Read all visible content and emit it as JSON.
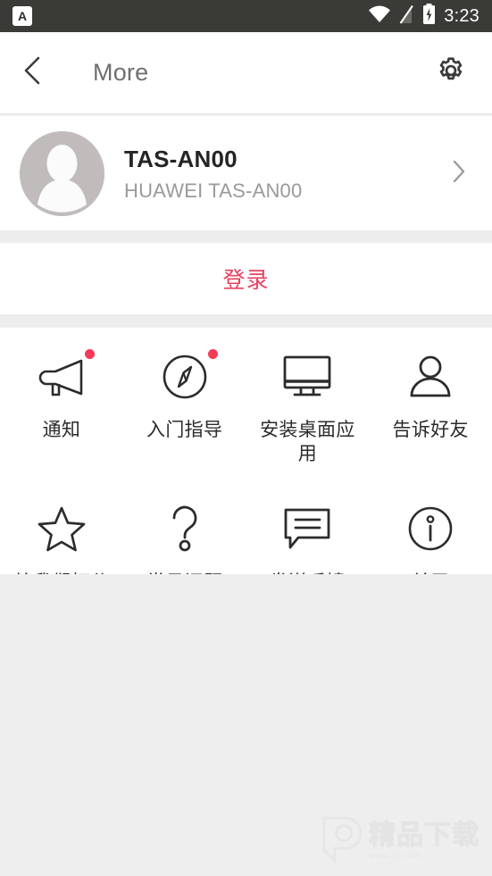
{
  "status_bar": {
    "app_badge_letter": "A",
    "wifi_icon": "wifi-icon",
    "signal_icon": "signal-off-icon",
    "battery_icon": "battery-charging-icon",
    "clock": "3:23",
    "background_color": "#3a3a36"
  },
  "app_bar": {
    "back_icon": "chevron-left-icon",
    "title": "More",
    "settings_icon": "gear-icon"
  },
  "profile": {
    "avatar_icon": "person-placeholder-avatar",
    "name": "TAS-AN00",
    "subtitle": "HUAWEI TAS-AN00",
    "chevron_icon": "chevron-right-icon"
  },
  "login": {
    "label": "登录",
    "color": "#e8415e"
  },
  "grid": {
    "badge_color": "#f73a55",
    "rows": [
      [
        {
          "label": "通知",
          "icon": "megaphone-icon",
          "badge": true
        },
        {
          "label": "入门指导",
          "icon": "compass-icon",
          "badge": true
        },
        {
          "label": "安装桌面应用",
          "icon": "monitor-icon",
          "badge": false
        },
        {
          "label": "告诉好友",
          "icon": "person-icon",
          "badge": false
        }
      ],
      [
        {
          "label": "给我们打分",
          "icon": "star-icon",
          "badge": false
        },
        {
          "label": "常见问题",
          "icon": "question-mark-icon",
          "badge": false
        },
        {
          "label": "发送反馈",
          "icon": "speech-bubble-icon",
          "badge": false
        },
        {
          "label": "关于",
          "icon": "info-circle-icon",
          "badge": false
        }
      ]
    ]
  },
  "watermark": {
    "logo_icon": "p-logo-icon",
    "text": "精品下载",
    "url": "www.jp.com"
  }
}
